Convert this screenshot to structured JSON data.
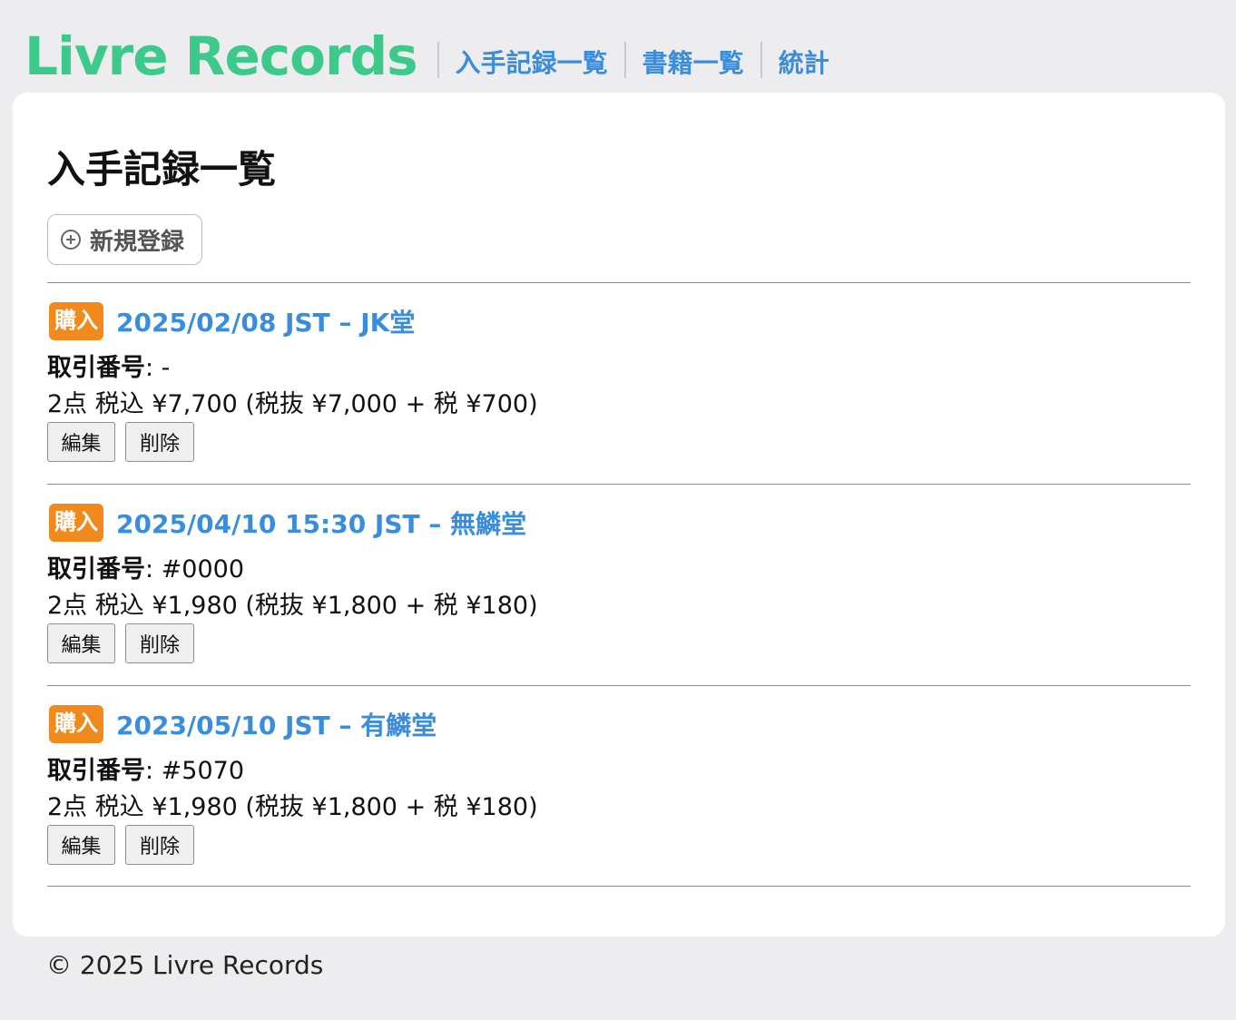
{
  "header": {
    "logo": "Livre Records",
    "nav": [
      {
        "label": "入手記録一覧"
      },
      {
        "label": "書籍一覧"
      },
      {
        "label": "統計"
      }
    ]
  },
  "main": {
    "title": "入手記録一覧",
    "new_button_label": "新規登録",
    "records": [
      {
        "badge": "購入",
        "title": "2025/02/08 JST – JK堂",
        "transaction_label": "取引番号",
        "transaction_value": ": -",
        "summary": "2点 税込 ¥7,700 (税抜 ¥7,000 + 税 ¥700)",
        "edit_label": "編集",
        "delete_label": "削除"
      },
      {
        "badge": "購入",
        "title": "2025/04/10 15:30 JST – 無鱗堂",
        "transaction_label": "取引番号",
        "transaction_value": ": #0000",
        "summary": "2点 税込 ¥1,980 (税抜 ¥1,800 + 税 ¥180)",
        "edit_label": "編集",
        "delete_label": "削除"
      },
      {
        "badge": "購入",
        "title": "2023/05/10 JST – 有鱗堂",
        "transaction_label": "取引番号",
        "transaction_value": ": #5070",
        "summary": "2点 税込 ¥1,980 (税抜 ¥1,800 + 税 ¥180)",
        "edit_label": "編集",
        "delete_label": "削除"
      }
    ]
  },
  "footer": {
    "copyright": "© 2025 Livre Records"
  },
  "colors": {
    "logo": "#3dc989",
    "link": "#3a8ddc",
    "badge": "#f08a1d",
    "background": "#ededef",
    "card": "#ffffff"
  }
}
